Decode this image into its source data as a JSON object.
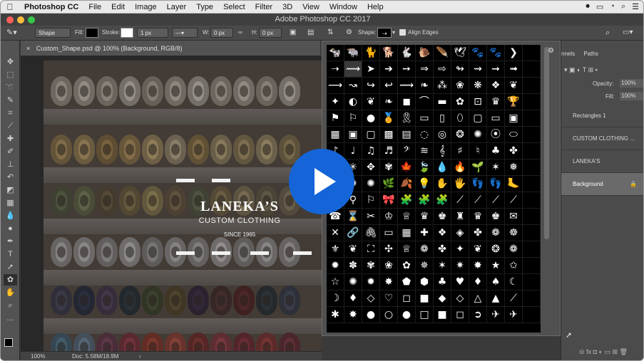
{
  "menubar": {
    "app_name": "Photoshop CC",
    "items": [
      "File",
      "Edit",
      "Image",
      "Layer",
      "Type",
      "Select",
      "Filter",
      "3D",
      "View",
      "Window",
      "Help"
    ]
  },
  "window": {
    "title": "Adobe Photoshop CC 2017"
  },
  "options": {
    "mode_value": "Shape",
    "fill_label": "Fill:",
    "stroke_label": "Stroke:",
    "stroke_width": "1 px",
    "w_label": "W:",
    "w_value": "0 px",
    "h_label": "H:",
    "h_value": "0 px",
    "shape_label": "Shape:",
    "align_label": "Align Edges"
  },
  "document": {
    "tab_label": "Custom_Shape.psd @ 100% (Background, RGB/8)",
    "zoom": "100%",
    "doc_size": "Doc: 5.58M/18.9M",
    "brand": "LANEKA’S",
    "tagline": "CUSTOM CLOTHING",
    "since": "SINCE 1965"
  },
  "panels": {
    "tabs": [
      "nnels",
      "Paths"
    ],
    "opacity_label": "Opacity:",
    "opacity_value": "100%",
    "fill_label": "Fill:",
    "fill_value": "100%",
    "layers": [
      "Rectangles 1",
      "CUSTOM CLOTHING ...",
      "LANEKA'S",
      "Background"
    ]
  },
  "shape_glyphs": [
    "🐄",
    "🐃",
    "🐈",
    "🐕",
    "🐇",
    "🐌",
    "🪶",
    "🕊",
    "🐾",
    "🐾",
    "❯",
    "",
    "➝",
    "⟿",
    "➤",
    "➔",
    "➙",
    "⇒",
    "⇨",
    "↬",
    "⇝",
    "➞",
    "➟",
    "",
    "⟶",
    "↝",
    "↪",
    "↩",
    "⟿",
    "❧",
    "⁂",
    "❀",
    "❋",
    "❖",
    "❦",
    "",
    "✦",
    "◐",
    "❦",
    "❧",
    "◼",
    "⌒",
    "▬",
    "✿",
    "⊡",
    "♛",
    "🏆",
    "",
    "⚑",
    "⚐",
    "●",
    "🏅",
    "🎗",
    "▭",
    "▯",
    "⬯",
    "▢",
    "▭",
    "▣",
    "",
    "▦",
    "▣",
    "▢",
    "▩",
    "▤",
    "◌",
    "◎",
    "❂",
    "✺",
    "⦿",
    "⬭",
    "",
    "♪",
    "♩",
    "♫",
    "♬",
    "𝄢",
    "≋",
    "𝄞",
    "♯",
    "♮",
    "♣",
    "✤",
    "",
    "❄",
    "✳",
    "✥",
    "✾",
    "🍁",
    "🍃",
    "💧",
    "🔥",
    "🌱",
    "✶",
    "❅",
    "",
    "✷",
    "✹",
    "✺",
    "🌿",
    "🍂",
    "💡",
    "✋",
    "🖐",
    "👣",
    "👣",
    "🦶",
    "",
    "➳",
    "⚲",
    "⚐",
    "🎀",
    "🧩",
    "🧩",
    "🧩",
    "⟋",
    "⟋",
    "⟋",
    "⟋",
    "",
    "☎",
    "⌛",
    "✂",
    "♔",
    "♕",
    "♛",
    "♚",
    "♜",
    "♛",
    "♚",
    "✉",
    "",
    "✕",
    "🔗",
    "🖇",
    "▭",
    "▦",
    "✚",
    "❖",
    "◈",
    "✤",
    "❁",
    "☸",
    "",
    "⚜",
    "❦",
    "⛶",
    "✣",
    "♕",
    "❁",
    "✤",
    "✦",
    "❦",
    "❂",
    "❁",
    "",
    "✹",
    "✽",
    "✾",
    "❀",
    "✿",
    "✵",
    "✶",
    "✷",
    "✸",
    "★",
    "✩",
    "",
    "☆",
    "✺",
    "✹",
    "✸",
    "⬟",
    "⬢",
    "♣",
    "♥",
    "♦",
    "♠",
    "☾",
    "",
    "☽",
    "♦",
    "◇",
    "♡",
    "◻",
    "■",
    "◆",
    "◇",
    "△",
    "▲",
    "⟋",
    "",
    "✱",
    "✸",
    "●",
    "○",
    "●",
    "□",
    "■",
    "◻",
    "➲",
    "✈",
    "✈",
    ""
  ]
}
